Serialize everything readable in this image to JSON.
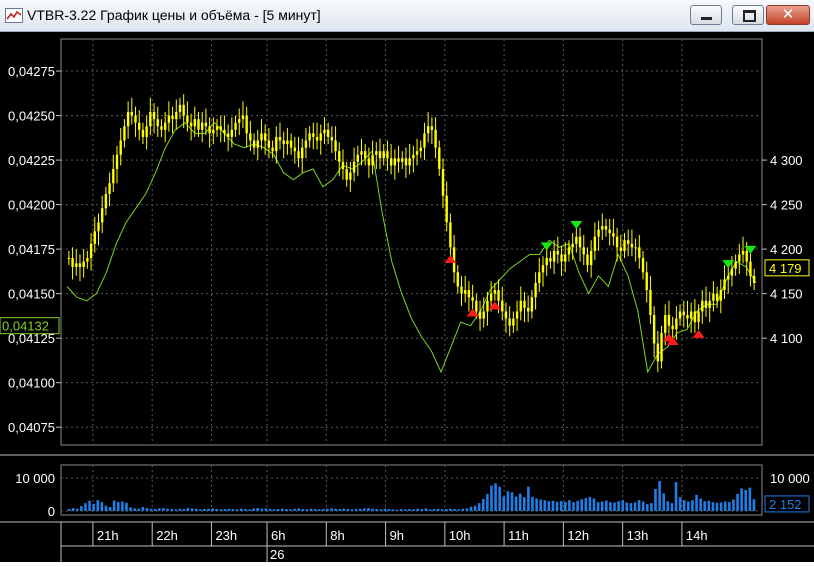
{
  "window": {
    "title": "VTBR-3.22 График цены и объёма - [5 минут]",
    "minimize_label": "minimize",
    "maximize_label": "maximize",
    "close_label": "✕"
  },
  "colors": {
    "background": "#000000",
    "candle": "#ffff00",
    "line": "#7fd321",
    "volume": "#1e7fe6",
    "signal_up": "#ff1a1a",
    "signal_down": "#16e816",
    "grid": "#5a5a5a",
    "text": "#ffffff"
  },
  "chart_data": [
    {
      "type": "candlestick",
      "title": "",
      "left_axis": {
        "ylim": [
          0.04065,
          0.04293
        ],
        "ticks": [
          "0,04275",
          "0,04250",
          "0,04225",
          "0,04200",
          "0,04175",
          "0,04150",
          "0,04125",
          "0,04100",
          "0,04075"
        ],
        "tick_values": [
          0.04275,
          0.0425,
          0.04225,
          0.042,
          0.04175,
          0.0415,
          0.04125,
          0.041,
          0.04075
        ],
        "current_label": "0,04132",
        "current_value": 0.04132
      },
      "right_axis": {
        "ticks": [
          "4 300",
          "4 250",
          "4 200",
          "4 150",
          "4 100"
        ],
        "tick_values": [
          4300,
          4250,
          4200,
          4150,
          4100
        ],
        "current_label": "4 179",
        "current_value": 4179
      },
      "grid": true,
      "series": [
        {
          "kind": "candles",
          "color": "#ffff00",
          "close": [
            0.0417,
            0.04165,
            0.04167,
            0.04165,
            0.04168,
            0.0417,
            0.04178,
            0.04185,
            0.0419,
            0.04198,
            0.04206,
            0.04212,
            0.0422,
            0.04228,
            0.04236,
            0.04244,
            0.04252,
            0.0425,
            0.04246,
            0.04242,
            0.04238,
            0.04244,
            0.04252,
            0.04248,
            0.04244,
            0.04242,
            0.04246,
            0.0425,
            0.04248,
            0.04252,
            0.04256,
            0.0425,
            0.04246,
            0.04244,
            0.04248,
            0.04242,
            0.04246,
            0.04244,
            0.0424,
            0.04242,
            0.04244,
            0.04242,
            0.0424,
            0.04238,
            0.04242,
            0.04246,
            0.04248,
            0.0425,
            0.0424,
            0.04236,
            0.04232,
            0.04236,
            0.0424,
            0.04236,
            0.04232,
            0.0423,
            0.04238,
            0.04236,
            0.04234,
            0.04236,
            0.04232,
            0.0423,
            0.04226,
            0.04232,
            0.04236,
            0.0424,
            0.04238,
            0.04236,
            0.0424,
            0.04242,
            0.04238,
            0.04236,
            0.0423,
            0.04224,
            0.0422,
            0.04214,
            0.04218,
            0.04224,
            0.04228,
            0.0423,
            0.04226,
            0.04222,
            0.04228,
            0.0423,
            0.04226,
            0.0423,
            0.04226,
            0.04222,
            0.04226,
            0.04224,
            0.04226,
            0.04222,
            0.04226,
            0.04228,
            0.0423,
            0.04232,
            0.0424,
            0.04244,
            0.04242,
            0.04232,
            0.0422,
            0.04205,
            0.0419,
            0.04176,
            0.04162,
            0.04154,
            0.0415,
            0.04152,
            0.04148,
            0.04146,
            0.0414,
            0.04136,
            0.0414,
            0.04146,
            0.0415,
            0.04152,
            0.04146,
            0.0414,
            0.04136,
            0.04132,
            0.04136,
            0.0414,
            0.04146,
            0.04142,
            0.0414,
            0.04148,
            0.04156,
            0.04162,
            0.04166,
            0.0417,
            0.04168,
            0.04174,
            0.04172,
            0.04168,
            0.04172,
            0.04176,
            0.04178,
            0.04182,
            0.04176,
            0.04172,
            0.04166,
            0.04174,
            0.04182,
            0.04186,
            0.04188,
            0.04186,
            0.04184,
            0.04182,
            0.04176,
            0.04174,
            0.0418,
            0.04178,
            0.04176,
            0.04176,
            0.0417,
            0.04162,
            0.04152,
            0.04138,
            0.04122,
            0.04112,
            0.04128,
            0.04138,
            0.04132,
            0.0413,
            0.04136,
            0.0414,
            0.04138,
            0.04136,
            0.0414,
            0.04134,
            0.0414,
            0.04146,
            0.04142,
            0.04146,
            0.0415,
            0.04146,
            0.04152,
            0.04158,
            0.0416,
            0.04164,
            0.04168,
            0.04172,
            0.04174,
            0.04168,
            0.0416,
            0.04156
          ]
        },
        {
          "kind": "line",
          "color": "#7fd321",
          "ref_close": [
            0.04154,
            0.04148,
            0.04146,
            0.0415,
            0.04162,
            0.04178,
            0.0419,
            0.04198,
            0.04206,
            0.04218,
            0.04232,
            0.04242,
            0.04246,
            0.0424,
            0.0424,
            0.04246,
            0.0424,
            0.04234,
            0.04232,
            0.04234,
            0.04232,
            0.04228,
            0.04218,
            0.04214,
            0.04218,
            0.0422,
            0.0421,
            0.04214,
            0.04222,
            0.0422,
            0.04224,
            0.0423,
            0.04196,
            0.04168,
            0.0415,
            0.04136,
            0.04126,
            0.04118,
            0.04106,
            0.0412,
            0.04134,
            0.04132,
            0.0414,
            0.04152,
            0.04158,
            0.04164,
            0.04168,
            0.04172,
            0.04172,
            0.0418,
            0.04176,
            0.04178,
            0.04162,
            0.0415,
            0.0416,
            0.04154,
            0.04172,
            0.0416,
            0.0414,
            0.04106,
            0.04116,
            0.0412,
            0.04128,
            0.0413,
            0.0414,
            0.04144,
            0.04144,
            0.04158,
            0.04168,
            0.04165,
            0.04156
          ]
        },
        {
          "kind": "signals",
          "up_x": [
            103,
            109,
            115,
            162,
            163,
            170
          ],
          "down_x": [
            129,
            137,
            178,
            184
          ],
          "up_color": "#ff1a1a",
          "down_color": "#16e816"
        }
      ],
      "x_tick_labels": [
        "21h",
        "22h",
        "23h",
        "6h",
        "8h",
        "9h",
        "10h",
        "11h",
        "12h",
        "13h",
        "14h"
      ],
      "x_tick_index": [
        7,
        23,
        39,
        54,
        70,
        86,
        102,
        118,
        134,
        150,
        166
      ],
      "date_label": "26",
      "date_index": 54
    },
    {
      "type": "bar",
      "title": "",
      "ylim": [
        0,
        14000
      ],
      "ticks": [
        "10 000",
        "0"
      ],
      "tick_values": [
        10000,
        0
      ],
      "right_ticks": [
        "10 000"
      ],
      "current_label": "2 152",
      "current_value": 2152,
      "grid": true,
      "values": [
        600,
        900,
        700,
        1500,
        2400,
        3100,
        2200,
        3300,
        2700,
        1600,
        1200,
        3200,
        2700,
        2900,
        2500,
        1100,
        800,
        700,
        1200,
        900,
        700,
        600,
        800,
        900,
        700,
        600,
        500,
        700,
        600,
        900,
        800,
        700,
        500,
        600,
        700,
        800,
        600,
        500,
        600,
        700,
        600,
        500,
        700,
        600,
        500,
        800,
        900,
        700,
        800,
        600,
        500,
        600,
        700,
        600,
        500,
        700,
        800,
        600,
        500,
        700,
        600,
        500,
        600,
        700,
        800,
        700,
        600,
        700,
        600,
        500,
        600,
        700,
        800,
        900,
        700,
        600,
        500,
        700,
        600,
        500,
        400,
        600,
        500,
        600,
        500,
        700,
        600,
        800,
        500,
        600,
        700,
        500,
        600,
        700,
        600,
        500,
        700,
        800,
        1300,
        1600,
        2400,
        3700,
        5200,
        7700,
        8400,
        7400,
        4400,
        6000,
        5700,
        4400,
        5300,
        4200,
        7400,
        4300,
        3800,
        3500,
        3300,
        3000,
        3100,
        2800,
        3000,
        2800,
        3300,
        2700,
        3100,
        3600,
        3900,
        4300,
        3800,
        2700,
        2900,
        3200,
        2700,
        2600,
        3000,
        3300,
        2600,
        2400,
        2600,
        3300,
        2900,
        2100,
        2400,
        6700,
        9100,
        5400,
        3000,
        2400,
        8800,
        4200,
        3300,
        2900,
        3300,
        4900,
        3800,
        3000,
        3100,
        2700,
        2500,
        2600,
        2900,
        2700,
        3500,
        5200,
        6900,
        6400,
        7100,
        3600
      ]
    }
  ]
}
